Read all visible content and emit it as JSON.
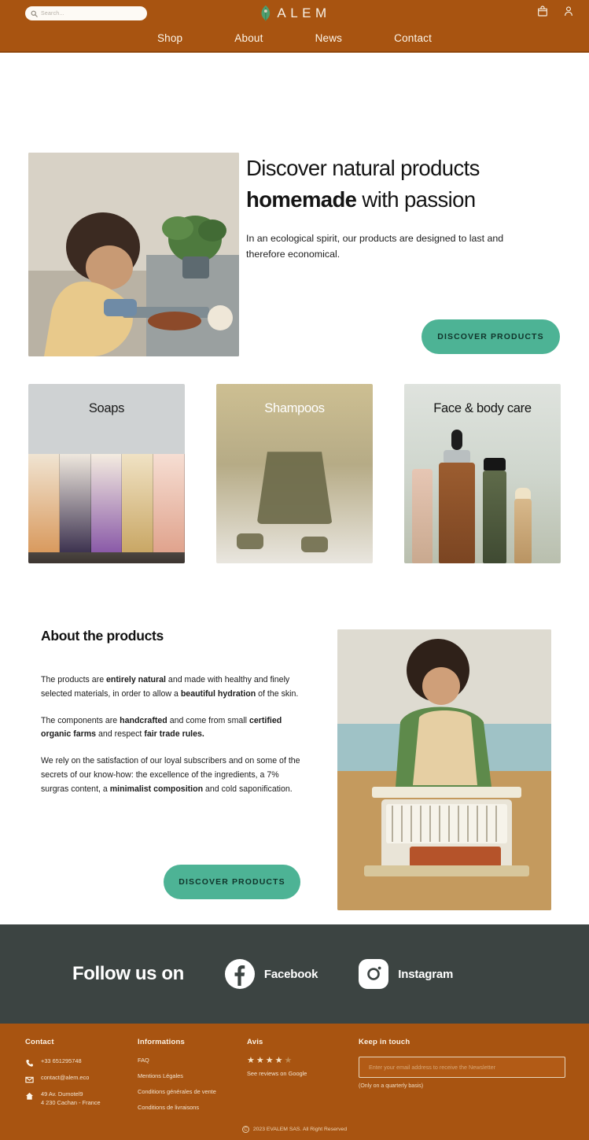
{
  "header": {
    "search": {
      "placeholder": "Search...",
      "icon": "search-icon"
    },
    "logo": {
      "word": "ALEM",
      "icon": "leaf-icon"
    },
    "actions": [
      {
        "name": "cart-icon",
        "label": "Cart"
      },
      {
        "name": "account-icon",
        "label": "Account"
      }
    ],
    "nav": [
      {
        "label": "Shop"
      },
      {
        "label": "About"
      },
      {
        "label": "News"
      },
      {
        "label": "Contact"
      }
    ]
  },
  "hero": {
    "title_line1": "Discover natural products",
    "title_bold": "homemade",
    "title_rest": " with passion",
    "subtitle": "In an ecological spirit, our products are designed to last and therefore economical.",
    "cta_label": "DISCOVER PRODUCTS",
    "image_alt": "Woman preparing natural soap ingredients at a table"
  },
  "categories": [
    {
      "label": "Soaps",
      "image_alt": "Row of colorful handmade soap bars"
    },
    {
      "label": "Shampoos",
      "image_alt": "Solid shampoo bar"
    },
    {
      "label": "Face & body care",
      "image_alt": "Serum dropper bottle, roll-on and balm"
    }
  ],
  "about": {
    "title": "About the products",
    "paragraphs": [
      {
        "parts": [
          {
            "text": "The products are ",
            "bold": false
          },
          {
            "text": "entirely natural",
            "bold": true
          },
          {
            "text": " and made with healthy and finely selected materials, in order to allow a ",
            "bold": false
          },
          {
            "text": "beautiful hydration",
            "bold": true
          },
          {
            "text": " of the skin.",
            "bold": false
          }
        ]
      },
      {
        "parts": [
          {
            "text": "The components are ",
            "bold": false
          },
          {
            "text": "handcrafted",
            "bold": true
          },
          {
            "text": " and come from small ",
            "bold": false
          },
          {
            "text": "certified organic farms",
            "bold": true
          },
          {
            "text": " and respect ",
            "bold": false
          },
          {
            "text": "fair trade rules.",
            "bold": true
          }
        ]
      },
      {
        "parts": [
          {
            "text": "We rely on the satisfaction of our loyal subscribers and on some of the secrets of our know-how: the excellence of the ingredients, a 7% surgras content, a ",
            "bold": false
          },
          {
            "text": "minimalist composition",
            "bold": true
          },
          {
            "text": " and cold saponification.",
            "bold": false
          }
        ]
      }
    ],
    "cta_label": "DISCOVER PRODUCTS",
    "image_alt": "Woman cutting a loaf of soap with a wire cutter"
  },
  "social": {
    "title": "Follow us on",
    "links": [
      {
        "label": "Facebook",
        "icon": "facebook-icon"
      },
      {
        "label": "Instagram",
        "icon": "instagram-icon"
      }
    ]
  },
  "footer": {
    "contact": {
      "heading": "Contact",
      "phone": "+33 651295748",
      "email": "contact@alem.eco",
      "address_line1": "49 Av. Dumotel9",
      "address_line2": "4 230 Cachan - France"
    },
    "informations": {
      "heading": "Informations",
      "links": [
        "FAQ",
        "Mentions Légales",
        "Conditions générales de vente",
        "Conditions de livraisons"
      ]
    },
    "avis": {
      "heading": "Avis",
      "rating": 4,
      "max_rating": 5,
      "link_label": "See reviews on Google"
    },
    "keep_in_touch": {
      "heading": "Keep in touch",
      "placeholder": "Enter your email address to receive the Newsletter",
      "value": "",
      "note": "(Only on a quarterly basis)"
    },
    "copyright": "2023 EVALEM SAS. All Right Reserved"
  },
  "colors": {
    "brand_brown": "#a85411",
    "accent_teal": "#4db395",
    "dark_panel": "#3c4442",
    "cream": "#f6ede0"
  }
}
